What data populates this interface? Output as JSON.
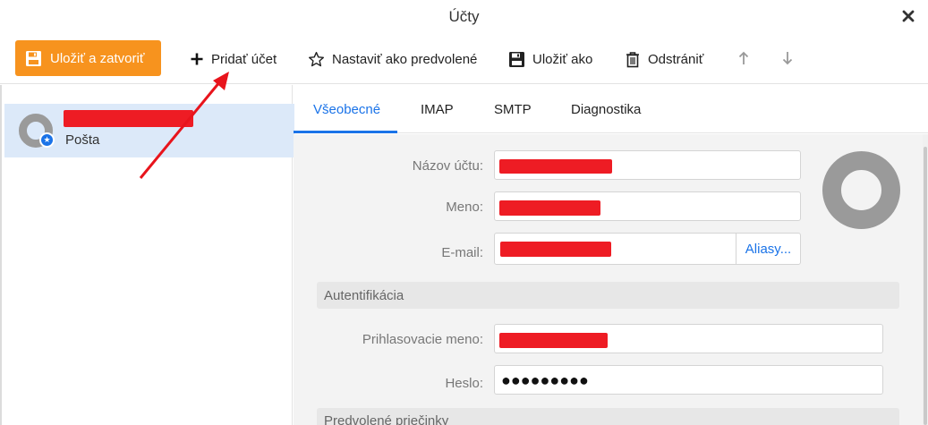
{
  "window": {
    "title": "Účty",
    "close_icon": "close-icon"
  },
  "toolbar": {
    "save_close_label": "Uložiť a zatvoriť",
    "add_account_label": "Pridať účet",
    "set_default_label": "Nastaviť ako predvolené",
    "save_as_label": "Uložiť ako",
    "delete_label": "Odstrániť",
    "accent_color": "#f7931e"
  },
  "accounts": {
    "items": [
      {
        "subtitle": "Pošta",
        "selected": true
      }
    ]
  },
  "tabs": [
    {
      "label": "Všeobecné",
      "active": true
    },
    {
      "label": "IMAP",
      "active": false
    },
    {
      "label": "SMTP",
      "active": false
    },
    {
      "label": "Diagnostika",
      "active": false
    }
  ],
  "form": {
    "account_name_label": "Názov účtu:",
    "name_label": "Meno:",
    "email_label": "E-mail:",
    "aliases_label": "Aliasy...",
    "auth_section": "Autentifikácia",
    "login_name_label": "Prihlasovacie meno:",
    "password_label": "Heslo:",
    "password_value": "●●●●●●●●●",
    "default_folders_section": "Predvolené priečinky"
  },
  "colors": {
    "link": "#1a73e8",
    "redaction": "#ee1c24",
    "annotation_arrow": "#e8141c"
  }
}
